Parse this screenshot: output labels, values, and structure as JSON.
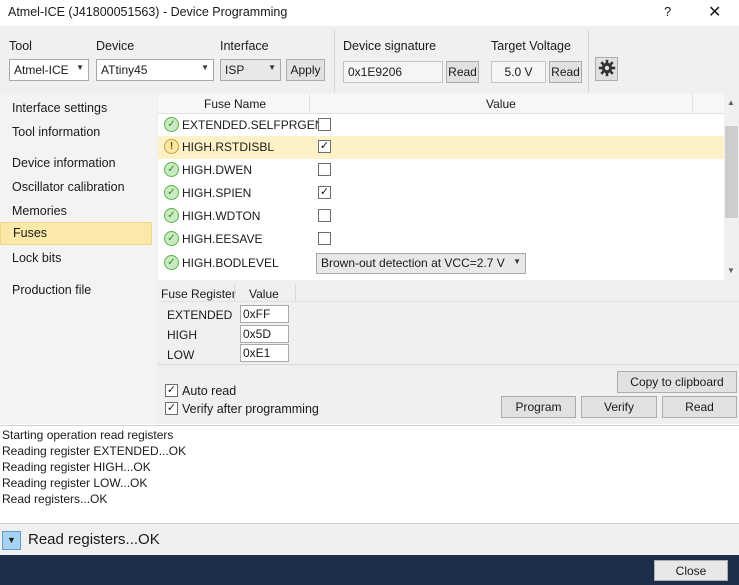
{
  "window": {
    "title": "Atmel-ICE (J41800051563) - Device Programming",
    "help_glyph": "?",
    "close_glyph": "✕"
  },
  "toolbar": {
    "tool_label": "Tool",
    "tool_value": "Atmel-ICE",
    "device_label": "Device",
    "device_value": "ATtiny45",
    "interface_label": "Interface",
    "interface_value": "ISP",
    "apply_label": "Apply",
    "signature_label": "Device signature",
    "signature_value": "0x1E9206",
    "signature_read_label": "Read",
    "voltage_label": "Target Voltage",
    "voltage_value": "5.0 V",
    "voltage_read_label": "Read",
    "settings_icon": "gear-icon"
  },
  "sidebar": {
    "items": [
      {
        "label": "Interface settings"
      },
      {
        "label": "Tool information"
      },
      {
        "label": "Device information"
      },
      {
        "label": "Oscillator calibration"
      },
      {
        "label": "Memories"
      },
      {
        "label": "Fuses"
      },
      {
        "label": "Lock bits"
      },
      {
        "label": "Production file"
      }
    ],
    "active": "Fuses"
  },
  "fuse_grid": {
    "col_name": "Fuse Name",
    "col_value": "Value",
    "rows": [
      {
        "name": "EXTENDED.SELFPRGEN",
        "status": "ok",
        "checked": false
      },
      {
        "name": "HIGH.RSTDISBL",
        "status": "warning",
        "checked": true
      },
      {
        "name": "HIGH.DWEN",
        "status": "ok",
        "checked": false
      },
      {
        "name": "HIGH.SPIEN",
        "status": "ok",
        "checked": true
      },
      {
        "name": "HIGH.WDTON",
        "status": "ok",
        "checked": false
      },
      {
        "name": "HIGH.EESAVE",
        "status": "ok",
        "checked": false
      },
      {
        "name": "HIGH.BODLEVEL",
        "status": "ok",
        "dropdown": "Brown-out detection at VCC=2.7 V"
      }
    ]
  },
  "registers": {
    "col_register": "Fuse Register",
    "col_value": "Value",
    "rows": [
      {
        "name": "EXTENDED",
        "value": "0xFF"
      },
      {
        "name": "HIGH",
        "value": "0x5D"
      },
      {
        "name": "LOW",
        "value": "0xE1"
      }
    ]
  },
  "options": {
    "auto_read_label": "Auto read",
    "auto_read_checked": true,
    "verify_label": "Verify after programming",
    "verify_checked": true
  },
  "actions": {
    "copy_label": "Copy to clipboard",
    "program_label": "Program",
    "verify_label": "Verify",
    "read_label": "Read"
  },
  "log": {
    "lines": [
      "Starting operation read registers",
      "Reading register EXTENDED...OK",
      "Reading register HIGH...OK",
      "Reading register LOW...OK",
      "Read registers...OK"
    ]
  },
  "status": {
    "text": "Read registers...OK",
    "toggle_glyph": "▼"
  },
  "footer": {
    "close_label": "Close"
  },
  "colors": {
    "active_nav": "#fbe9a9",
    "footer_bg": "#1f2d4d",
    "ok_icon": "#5bb24b",
    "warn_icon": "#c9a13c"
  }
}
